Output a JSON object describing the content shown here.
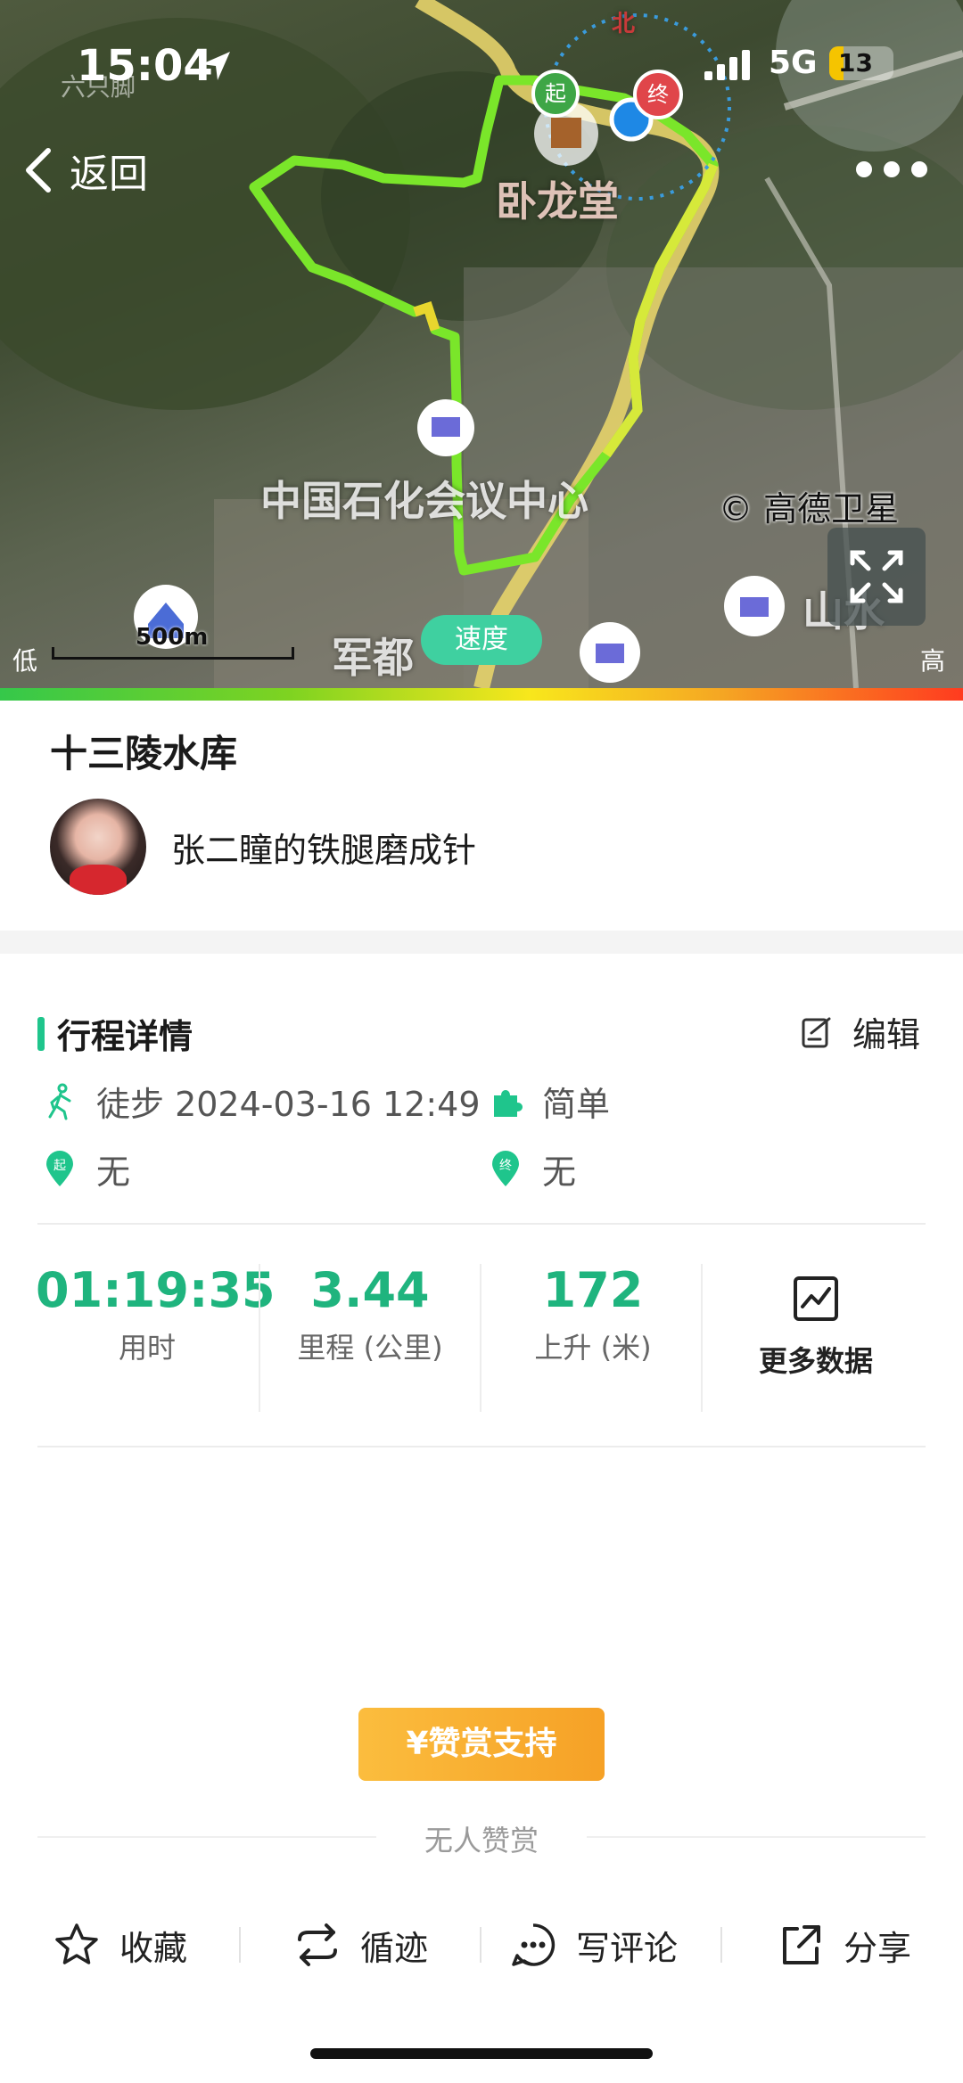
{
  "status_bar": {
    "time": "15:04",
    "network": "5G",
    "battery": "13"
  },
  "map": {
    "watermark": "六只脚",
    "back_label": "返回",
    "compass": "北",
    "start_marker": "起",
    "end_marker": "终",
    "labels": {
      "landmark": "卧龙堂",
      "center": "中国石化会议中心",
      "bottom_left": "军都",
      "bottom_right": "山水"
    },
    "copyright": "© 高德卫星",
    "scale": "500m",
    "speed_button": "速度",
    "legend_low": "低",
    "legend_high": "高"
  },
  "route": {
    "title": "十三陵水库",
    "username": "张二瞳的铁腿磨成针"
  },
  "details": {
    "section_title": "行程详情",
    "edit_label": "编辑",
    "activity": "徒步 2024-03-16 12:49",
    "difficulty": "简单",
    "start_point": "无",
    "end_point": "无",
    "start_icon_text": "起",
    "end_icon_text": "终"
  },
  "stats": [
    {
      "value": "01:19:35",
      "label": "用时"
    },
    {
      "value": "3.44",
      "label": "里程 (公里)"
    },
    {
      "value": "172",
      "label": "上升 (米)"
    }
  ],
  "more_data_label": "更多数据",
  "reward": {
    "button": "¥赞赏支持",
    "note": "无人赞赏"
  },
  "actions": {
    "favorite": "收藏",
    "follow_track": "循迹",
    "comment": "写评论",
    "share": "分享"
  },
  "colors": {
    "accent": "#1fb47e",
    "reward": "#f7a92c",
    "speed_pill": "#3fd0a0"
  }
}
